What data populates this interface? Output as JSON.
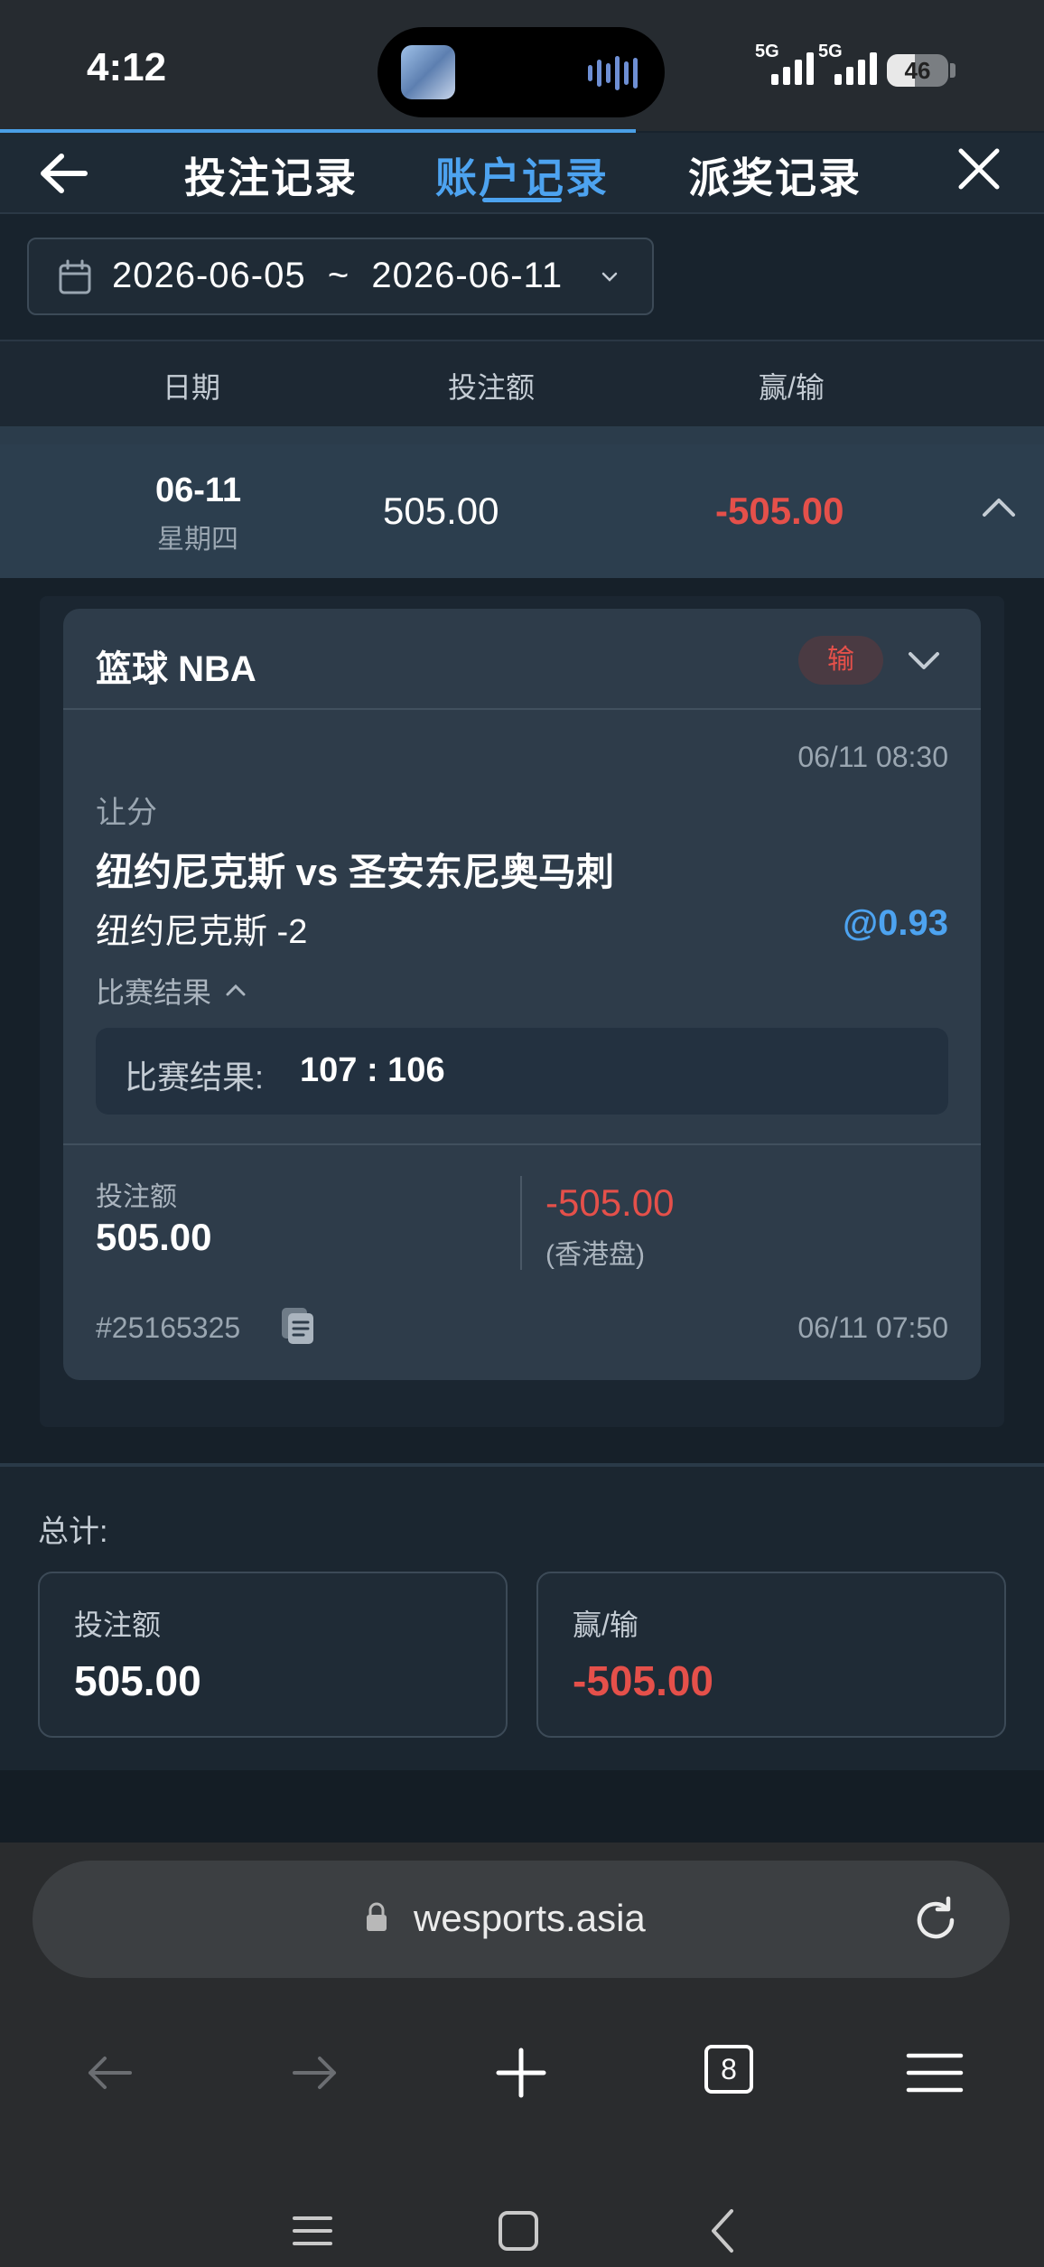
{
  "status_bar": {
    "time": "4:12",
    "network_1": "5G",
    "network_2": "5G",
    "battery": "46"
  },
  "header": {
    "tabs": [
      {
        "label": "投注记录",
        "active": false
      },
      {
        "label": "账户记录",
        "active": true
      },
      {
        "label": "派奖记录",
        "active": false
      }
    ],
    "back_icon": "arrow-left-icon",
    "close_icon": "close-icon"
  },
  "date_filter": {
    "range": "2026-06-05  ~  2026-06-11"
  },
  "columns": {
    "date": "日期",
    "stake": "投注额",
    "win_loss": "赢/输"
  },
  "day_row": {
    "date": "06-11",
    "weekday": "星期四",
    "stake": "505.00",
    "win_loss": "-505.00"
  },
  "bet_card": {
    "sport": "篮球 NBA",
    "status": "输",
    "bet_time": "06/11 08:30",
    "bet_type": "让分",
    "match": "纽约尼克斯 vs 圣安东尼奥马刺",
    "selection": "纽约尼克斯 -2",
    "odds": "@0.93",
    "result_toggle": "比赛结果",
    "result_label": "比赛结果:",
    "result_score": "107 : 106",
    "stake_label": "投注额",
    "stake": "505.00",
    "win_loss": "-505.00",
    "odds_type": "(香港盘)",
    "bet_id": "#25165325",
    "placed_time": "06/11 07:50"
  },
  "totals": {
    "label": "总计:",
    "stake_label": "投注额",
    "stake": "505.00",
    "win_loss_label": "赢/输",
    "win_loss": "-505.00"
  },
  "browser": {
    "url": "wesports.asia",
    "tab_count": "8"
  },
  "colors": {
    "accent": "#4da3f0",
    "loss": "#e5504a",
    "background": "#18232d"
  }
}
